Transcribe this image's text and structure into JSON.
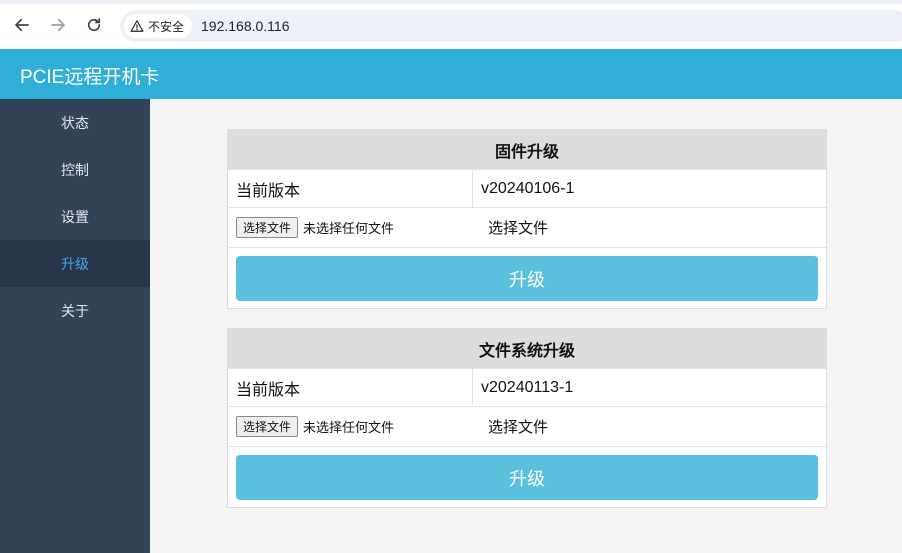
{
  "browser": {
    "security_label": "不安全",
    "url": "192.168.0.116"
  },
  "app": {
    "title": "PCIE远程开机卡"
  },
  "sidebar": {
    "items": [
      {
        "label": "状态"
      },
      {
        "label": "控制"
      },
      {
        "label": "设置"
      },
      {
        "label": "升级",
        "active": true
      },
      {
        "label": "关于"
      }
    ]
  },
  "firmware": {
    "title": "固件升级",
    "version_label": "当前版本",
    "version_value": "v20240106-1",
    "file_button": "选择文件",
    "file_none": "未选择任何文件",
    "file_label": "选择文件",
    "upgrade_button": "升级"
  },
  "filesystem": {
    "title": "文件系统升级",
    "version_label": "当前版本",
    "version_value": "v20240113-1",
    "file_button": "选择文件",
    "file_none": "未选择任何文件",
    "file_label": "选择文件",
    "upgrade_button": "升级"
  },
  "colors": {
    "header": "#2fafd7",
    "sidebar": "#334357",
    "sidebar_active": "#27364a",
    "active_text": "#4aa3f0",
    "button": "#5bc0de"
  }
}
